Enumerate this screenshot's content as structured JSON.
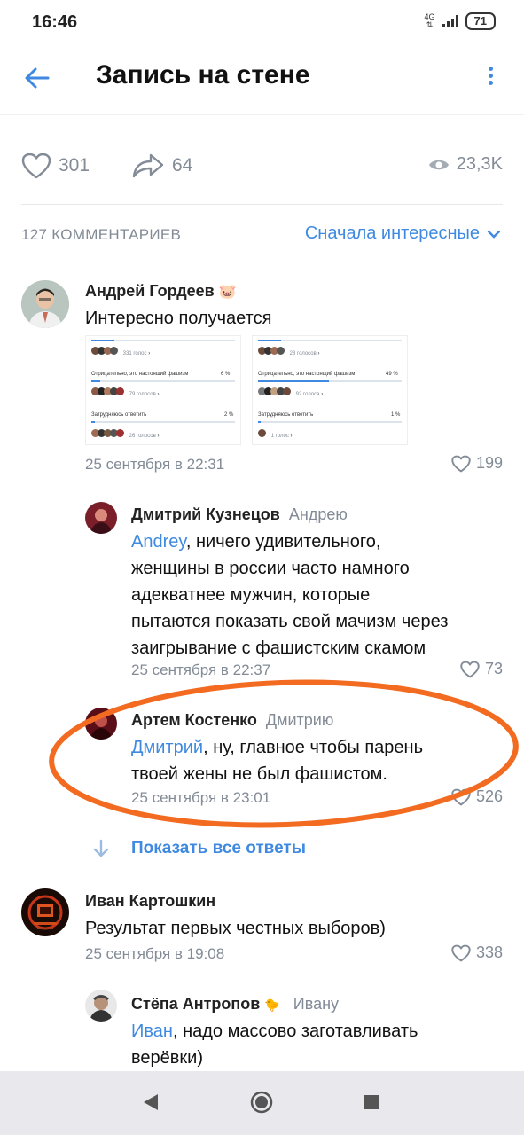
{
  "status_bar": {
    "time": "16:46",
    "network": "4G",
    "battery": "71"
  },
  "header": {
    "title": "Запись на стене"
  },
  "post_stats": {
    "likes": "301",
    "reposts": "64",
    "views": "23,3K"
  },
  "comments_header": {
    "count_label": "127 КОММЕНТАРИЕВ",
    "sort_label": "Сначала интересные"
  },
  "comments": [
    {
      "author": "Андрей Гордеев",
      "author_emoji": "🐷",
      "text": "Интересно получается",
      "date": "25 сентября в 22:31",
      "likes": "199",
      "poll_left": {
        "votes_1": "331 голос",
        "option_2": "Отрицательно, это настоящий фашизм",
        "pct_2": "6 %",
        "votes_2": "79 голосов",
        "option_3": "Затрудняюсь ответить",
        "pct_3": "2 %",
        "votes_3": "26 голосов"
      },
      "poll_right": {
        "votes_1": "28 голосов",
        "option_2": "Отрицательно, это настоящий фашизм",
        "pct_2": "49 %",
        "votes_2": "92 голоса",
        "option_3": "Затрудняюсь ответить",
        "pct_3": "1 %",
        "votes_3": "1 голос"
      }
    },
    {
      "author": "Дмитрий Кузнецов",
      "reply_to": "Андрею",
      "mention": "Andrey",
      "text": ", ничего удивительного,",
      "text_lines": [
        "женщины в россии часто намного",
        "адекватнее мужчин, которые",
        "пытаются показать свой мачизм через",
        "заигрывание с фашистским скамом"
      ],
      "date": "25 сентября в 22:37",
      "likes": "73"
    },
    {
      "author": "Артем Костенко",
      "reply_to": "Дмитрию",
      "mention": "Дмитрий",
      "text": ", ну, главное чтобы парень",
      "text_line2": "твоей жены не был фашистом.",
      "date": "25 сентября в 23:01",
      "likes": "526"
    },
    {
      "author": "Иван Картошкин",
      "text": "Результат первых честных выборов)",
      "date": "25 сентября в 19:08",
      "likes": "338"
    },
    {
      "author": "Стёпа Антропов",
      "author_emoji": "🐤",
      "reply_to": "Ивану",
      "mention": "Иван",
      "text": ", надо массово заготавливать",
      "text_line2": "верёвки)"
    }
  ],
  "show_all_replies": "Показать все ответы",
  "colors": {
    "accent": "#3f8ae0",
    "secondary": "#828b96",
    "highlight": "#f26b21"
  },
  "icons": [
    "arrow-left-icon",
    "more-vertical-icon",
    "heart-icon",
    "share-icon",
    "eye-icon",
    "chevron-down-icon",
    "arrow-down-icon",
    "nav-back-icon",
    "nav-home-icon",
    "nav-recents-icon"
  ]
}
